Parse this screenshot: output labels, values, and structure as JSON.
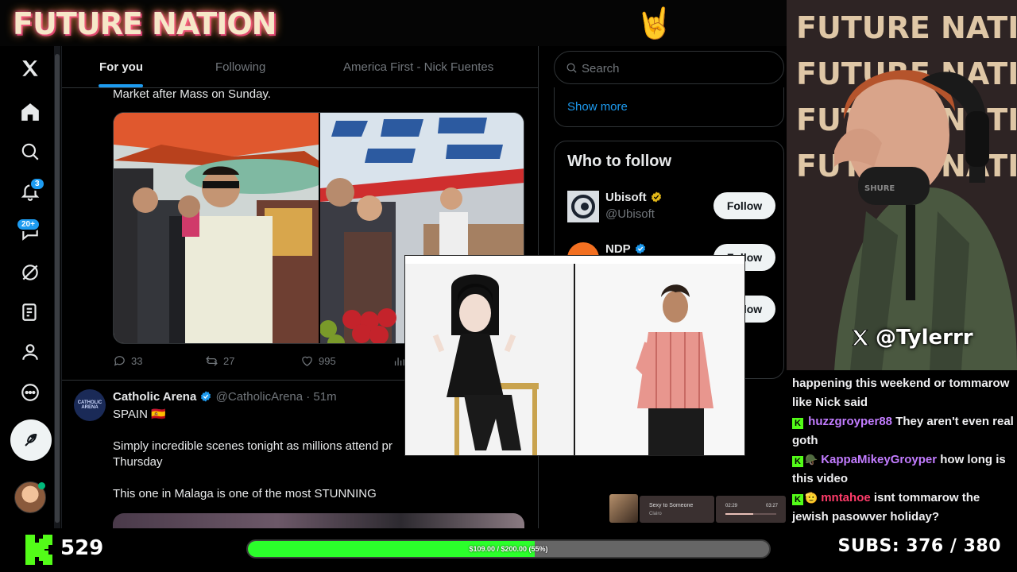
{
  "stream": {
    "logo_text": "FUTURE NATION",
    "handle": "@Tylerrr",
    "follower_count": "529",
    "goal": {
      "label": "$109.00 / $200.00 (55%)",
      "progress_percent": 55
    },
    "subs": {
      "label": "SUBS:",
      "value": "376 / 380"
    }
  },
  "x_nav": {
    "notifications_badge": "3",
    "messages_badge": "20+"
  },
  "feed": {
    "tabs": [
      {
        "label": "For you",
        "active": true
      },
      {
        "label": "Following",
        "active": false
      },
      {
        "label": "America First - Nick Fuentes",
        "active": false
      }
    ],
    "tweet1": {
      "text_tail": "Market after Mass on Sunday.",
      "replies": "33",
      "reposts": "27",
      "likes": "995"
    },
    "tweet2": {
      "avatar_text": "CATHOLIC ARENA",
      "author": "Catholic Arena",
      "handle": "@CatholicArena · 51m",
      "line1": "SPAIN 🇪🇸",
      "line2a": "Simply incredible scenes tonight as millions attend pr",
      "line2b": "Thursday",
      "line3": "This one in Malaga is one of the most STUNNING"
    }
  },
  "right_col": {
    "search_placeholder": "Search",
    "show_more": "Show more",
    "who_to_follow": "Who to follow",
    "accounts": [
      {
        "name": "Ubisoft",
        "handle": "@Ubisoft",
        "follow": "Follow"
      },
      {
        "name": "NDP",
        "handle": "",
        "follow": "Follow"
      },
      {
        "name": "",
        "handle": "",
        "follow": "Follow"
      }
    ]
  },
  "chat": {
    "messages": [
      {
        "text": "happening this weekend or tommarow like Nick said"
      },
      {
        "user": "huzzgroyper88",
        "user_color": "#c27cff",
        "text": "They aren't even real goth"
      },
      {
        "user": "KappaMikeyGroyper",
        "user_color": "#c27cff",
        "text": "how long is this video"
      },
      {
        "user": "mntahoe",
        "user_color": "#ff3c6a",
        "text": "isnt tommarow the jewish pasowver holiday?"
      }
    ]
  },
  "music": {
    "title": "Sexy to Someone",
    "artist": "Clairo",
    "elapsed": "02:29",
    "total": "03:27",
    "progress_fraction": 0.55
  },
  "colors": {
    "x_blue": "#1d9bf0",
    "kick_green": "#53fc18",
    "goal_green": "#2bff2b"
  }
}
